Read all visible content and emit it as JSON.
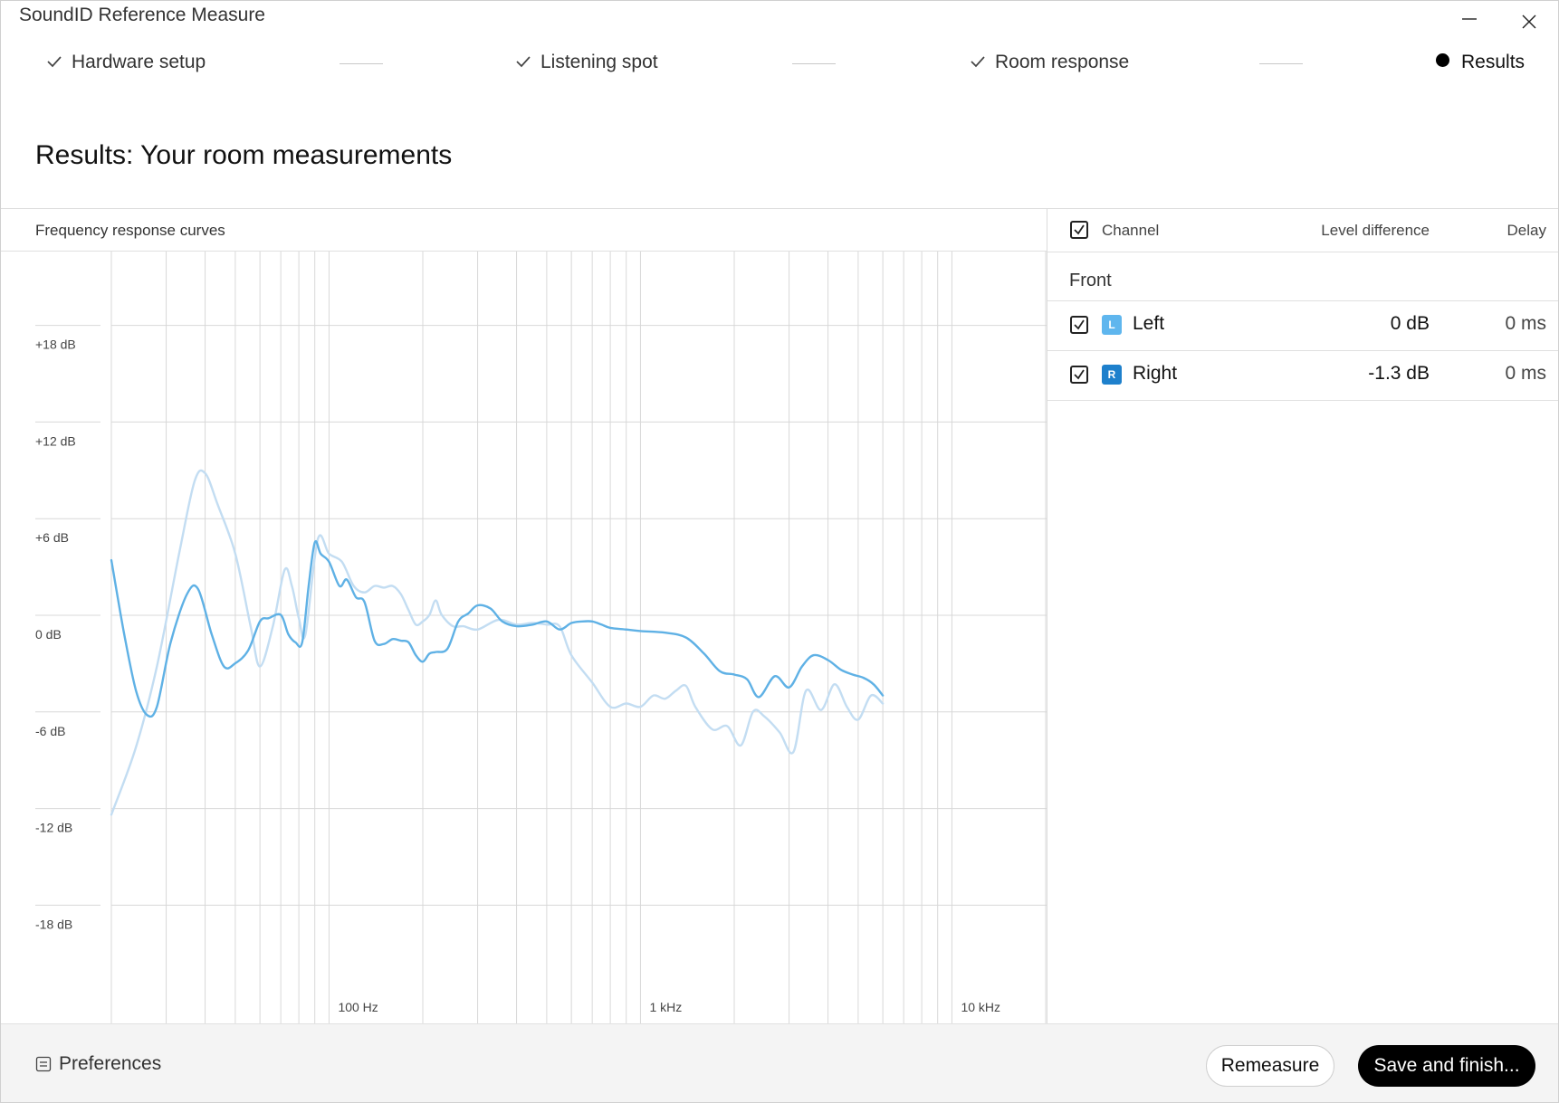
{
  "window": {
    "title": "SoundID Reference Measure",
    "minimize_icon": "minimize-icon",
    "close_icon": "close-icon"
  },
  "steps": [
    {
      "label": "Hardware setup",
      "state": "done",
      "icon": "check-icon"
    },
    {
      "label": "Listening spot",
      "state": "done",
      "icon": "check-icon"
    },
    {
      "label": "Room response",
      "state": "done",
      "icon": "check-icon"
    },
    {
      "label": "Results",
      "state": "current",
      "icon": "dot-icon"
    }
  ],
  "page": {
    "title": "Results: Your room measurements"
  },
  "chart_panel": {
    "label": "Frequency response curves"
  },
  "chart_data": {
    "type": "line",
    "title": "Frequency response curves",
    "xlabel": "",
    "ylabel": "",
    "x_scale": "log",
    "xlim": [
      20,
      20000
    ],
    "ylim": [
      -24,
      24
    ],
    "yticks": [
      {
        "value": 18,
        "label": "+18 dB"
      },
      {
        "value": 12,
        "label": "+12 dB"
      },
      {
        "value": 6,
        "label": "+6 dB"
      },
      {
        "value": 0,
        "label": "0 dB"
      },
      {
        "value": -6,
        "label": "-6 dB"
      },
      {
        "value": -12,
        "label": "-12 dB"
      },
      {
        "value": -18,
        "label": "-18 dB"
      }
    ],
    "xticks": [
      {
        "value": 100,
        "label": "100 Hz"
      },
      {
        "value": 1000,
        "label": "1 kHz"
      },
      {
        "value": 10000,
        "label": "10 kHz"
      }
    ],
    "grid": true,
    "legend": "none",
    "series": [
      {
        "channel": "Left",
        "color": "#c3ddf2",
        "points": [
          [
            20,
            -11.2
          ],
          [
            24,
            -7
          ],
          [
            28,
            -2
          ],
          [
            33,
            5
          ],
          [
            37,
            9.5
          ],
          [
            40,
            10
          ],
          [
            44,
            8
          ],
          [
            50,
            5
          ],
          [
            56,
            0.5
          ],
          [
            60,
            -2
          ],
          [
            66,
            0.5
          ],
          [
            72,
            4
          ],
          [
            76,
            3
          ],
          [
            80,
            1
          ],
          [
            84,
            0
          ],
          [
            92,
            5.9
          ],
          [
            100,
            5
          ],
          [
            110,
            4.5
          ],
          [
            120,
            3
          ],
          [
            130,
            2.6
          ],
          [
            140,
            3
          ],
          [
            150,
            2.9
          ],
          [
            160,
            3
          ],
          [
            170,
            2.5
          ],
          [
            180,
            1.5
          ],
          [
            190,
            0.6
          ],
          [
            200,
            0.8
          ],
          [
            210,
            1.2
          ],
          [
            220,
            2.1
          ],
          [
            230,
            1.2
          ],
          [
            250,
            0.5
          ],
          [
            270,
            0.5
          ],
          [
            300,
            0.3
          ],
          [
            350,
            0.9
          ],
          [
            400,
            0.6
          ],
          [
            450,
            0.7
          ],
          [
            500,
            0.6
          ],
          [
            550,
            0.5
          ],
          [
            600,
            -1.3
          ],
          [
            700,
            -3
          ],
          [
            800,
            -4.5
          ],
          [
            900,
            -4.3
          ],
          [
            1000,
            -4.5
          ],
          [
            1100,
            -3.8
          ],
          [
            1200,
            -4
          ],
          [
            1300,
            -3.5
          ],
          [
            1400,
            -3.2
          ],
          [
            1500,
            -4.5
          ],
          [
            1700,
            -5.9
          ],
          [
            1900,
            -5.7
          ],
          [
            2100,
            -6.9
          ],
          [
            2300,
            -4.8
          ],
          [
            2500,
            -5.1
          ],
          [
            2800,
            -6.1
          ],
          [
            3100,
            -7.3
          ],
          [
            3400,
            -3.5
          ],
          [
            3800,
            -4.7
          ],
          [
            4200,
            -3.1
          ],
          [
            4600,
            -4.5
          ],
          [
            5000,
            -5.3
          ],
          [
            5500,
            -3.8
          ],
          [
            6000,
            -4.3
          ]
        ]
      },
      {
        "channel": "Right",
        "color": "#5fb1e5",
        "points": [
          [
            20,
            4.6
          ],
          [
            22,
            0
          ],
          [
            24,
            -3.5
          ],
          [
            26,
            -5
          ],
          [
            28,
            -4.5
          ],
          [
            31,
            -0.5
          ],
          [
            35,
            2.5
          ],
          [
            38,
            2.8
          ],
          [
            42,
            0
          ],
          [
            46,
            -2
          ],
          [
            50,
            -1.8
          ],
          [
            55,
            -1
          ],
          [
            60,
            0.8
          ],
          [
            64,
            1
          ],
          [
            70,
            1.2
          ],
          [
            74,
            0
          ],
          [
            78,
            -0.5
          ],
          [
            82,
            -0.5
          ],
          [
            86,
            3
          ],
          [
            90,
            5.7
          ],
          [
            94,
            5
          ],
          [
            100,
            4.5
          ],
          [
            108,
            3
          ],
          [
            114,
            3.4
          ],
          [
            122,
            2.3
          ],
          [
            130,
            2
          ],
          [
            140,
            -0.4
          ],
          [
            150,
            -0.6
          ],
          [
            160,
            -0.3
          ],
          [
            170,
            -0.4
          ],
          [
            180,
            -0.5
          ],
          [
            190,
            -1.3
          ],
          [
            200,
            -1.7
          ],
          [
            210,
            -1.2
          ],
          [
            220,
            -1.1
          ],
          [
            240,
            -0.9
          ],
          [
            260,
            0.8
          ],
          [
            280,
            1.3
          ],
          [
            300,
            1.8
          ],
          [
            330,
            1.6
          ],
          [
            360,
            0.8
          ],
          [
            400,
            0.5
          ],
          [
            450,
            0.6
          ],
          [
            500,
            0.8
          ],
          [
            550,
            0.3
          ],
          [
            600,
            0.7
          ],
          [
            650,
            0.8
          ],
          [
            700,
            0.8
          ],
          [
            750,
            0.6
          ],
          [
            800,
            0.4
          ],
          [
            900,
            0.3
          ],
          [
            1000,
            0.2
          ],
          [
            1200,
            0.1
          ],
          [
            1400,
            -0.2
          ],
          [
            1600,
            -1.2
          ],
          [
            1800,
            -2.3
          ],
          [
            2000,
            -2.5
          ],
          [
            2200,
            -2.8
          ],
          [
            2400,
            -3.9
          ],
          [
            2700,
            -2.6
          ],
          [
            3000,
            -3.3
          ],
          [
            3300,
            -2
          ],
          [
            3600,
            -1.3
          ],
          [
            4000,
            -1.6
          ],
          [
            4400,
            -2.2
          ],
          [
            4800,
            -2.5
          ],
          [
            5200,
            -2.7
          ],
          [
            5600,
            -3.1
          ],
          [
            6000,
            -3.8
          ]
        ]
      }
    ]
  },
  "channel_table": {
    "header": {
      "channel": "Channel",
      "level_difference": "Level difference",
      "delay": "Delay"
    },
    "group": "Front",
    "rows": [
      {
        "badge": "L",
        "name": "Left",
        "level": "0 dB",
        "delay": "0 ms",
        "checked": true,
        "badge_color": "#5fb6ee"
      },
      {
        "badge": "R",
        "name": "Right",
        "level": "-1.3 dB",
        "delay": "0 ms",
        "checked": true,
        "badge_color": "#1e80cc"
      }
    ]
  },
  "footer": {
    "preferences_label": "Preferences",
    "preferences_icon": "preferences-icon",
    "remeasure_label": "Remeasure",
    "save_label": "Save and finish..."
  },
  "colors": {
    "accent": "#5fb1e5",
    "primary_button": "#000000",
    "grid": "#d8d8d8"
  }
}
